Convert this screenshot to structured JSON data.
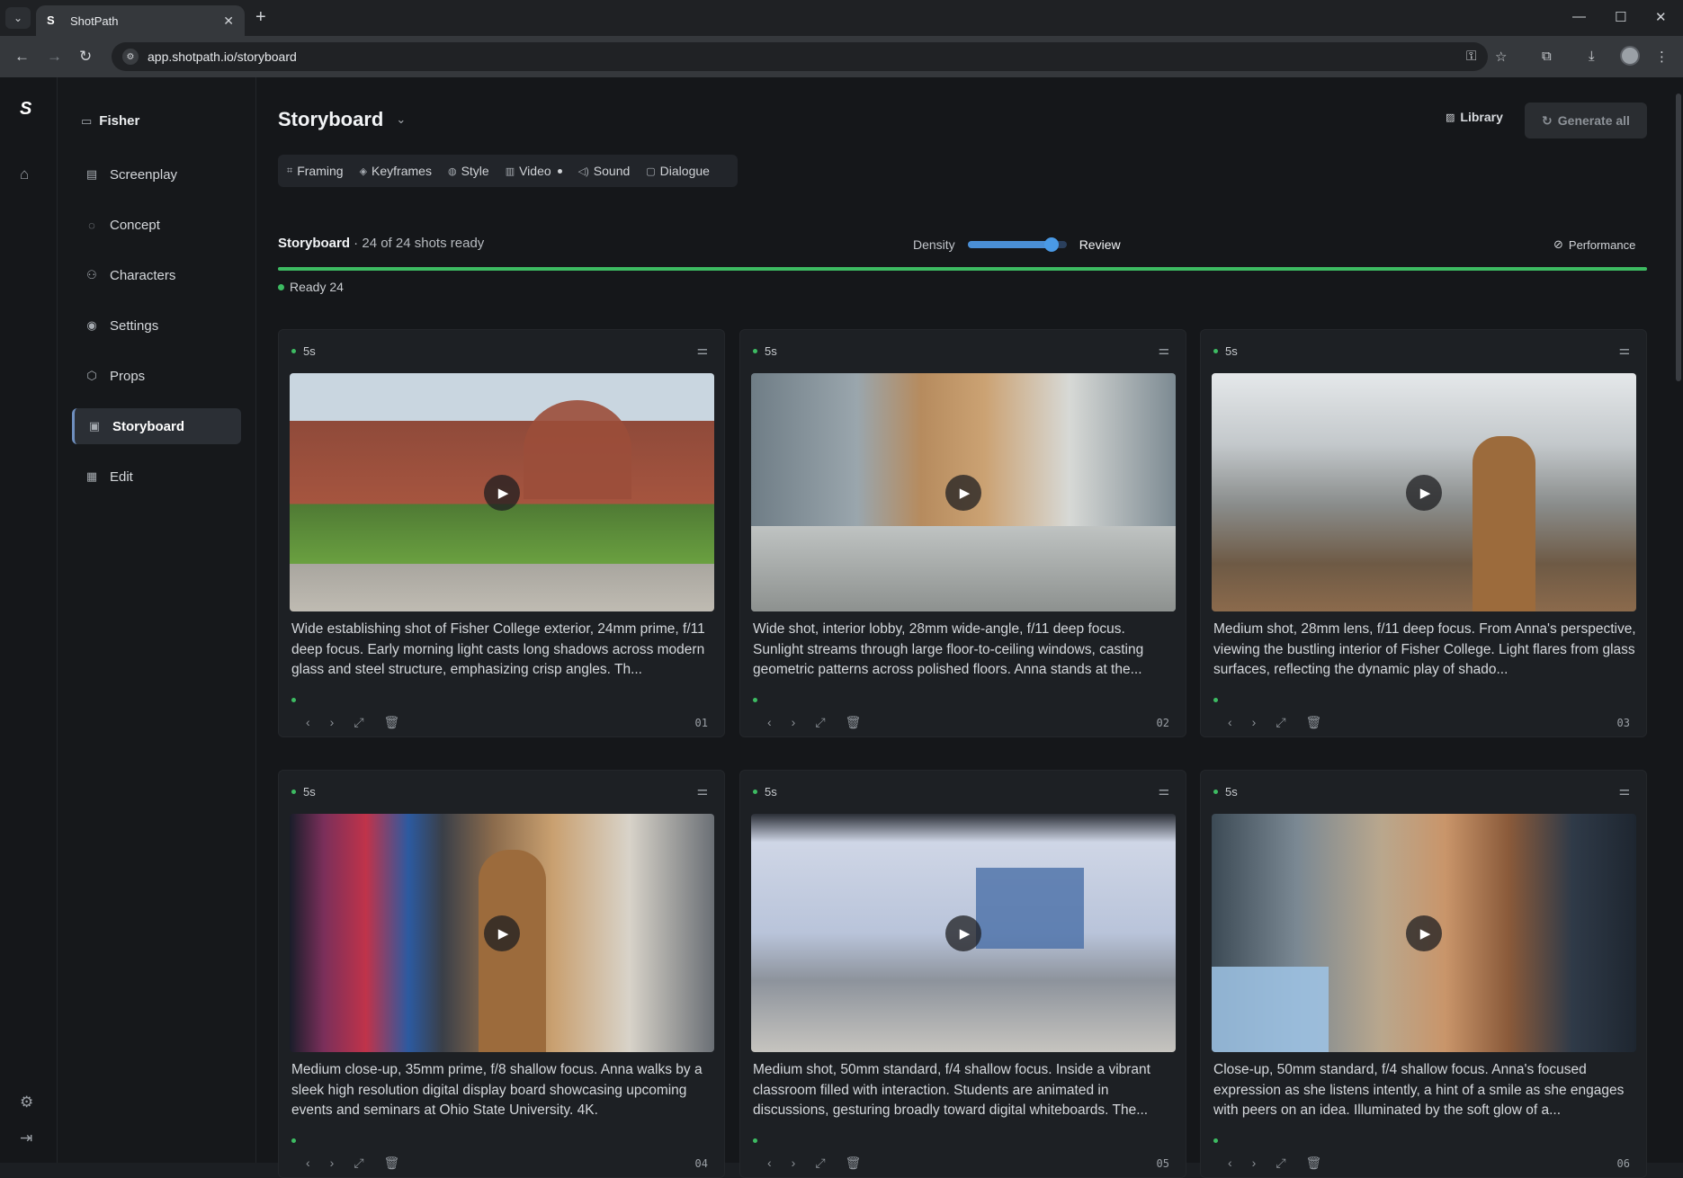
{
  "browser": {
    "tab_title": "ShotPath",
    "tab_favicon": "S",
    "url": "app.shotpath.io/storyboard"
  },
  "app": {
    "logo": "S",
    "project": "Fisher",
    "nav": [
      {
        "label": "Screenplay",
        "icon": "doc-icon"
      },
      {
        "label": "Concept",
        "icon": "lightbulb-icon"
      },
      {
        "label": "Characters",
        "icon": "users-icon"
      },
      {
        "label": "Settings",
        "icon": "pin-icon"
      },
      {
        "label": "Props",
        "icon": "box-icon"
      },
      {
        "label": "Storyboard",
        "icon": "storyboard-icon",
        "active": true
      },
      {
        "label": "Edit",
        "icon": "film-icon"
      }
    ]
  },
  "header": {
    "title": "Storyboard",
    "library_label": "Library",
    "generate_label": "Generate all"
  },
  "toolbar": {
    "framing": "Framing",
    "keyframes": "Keyframes",
    "style": "Style",
    "video": "Video",
    "sound": "Sound",
    "dialogue": "Dialogue"
  },
  "status": {
    "title": "Storyboard",
    "summary": "24 of 24 shots ready",
    "density_label": "Density",
    "density_mode": "Review",
    "density_value": 0.85,
    "performance_label": "Performance",
    "progress": 1.0,
    "ready_label": "Ready 24"
  },
  "shots": [
    {
      "duration": "5s",
      "number": "01",
      "desc": "Wide establishing shot of Fisher College exterior, 24mm prime, f/11 deep focus. Early morning light casts long shadows across modern glass and steel structure, emphasizing crisp angles. Th..."
    },
    {
      "duration": "5s",
      "number": "02",
      "desc": "Wide shot, interior lobby, 28mm wide-angle, f/11 deep focus. Sunlight streams through large floor-to-ceiling windows, casting geometric patterns across polished floors. Anna stands at the..."
    },
    {
      "duration": "5s",
      "number": "03",
      "desc": "Medium shot, 28mm lens, f/11 deep focus. From Anna's perspective, viewing the bustling interior of Fisher College. Light flares from glass surfaces, reflecting the dynamic play of shado..."
    },
    {
      "duration": "5s",
      "number": "04",
      "desc": "Medium close-up, 35mm prime, f/8 shallow focus. Anna walks by a sleek high resolution digital display board showcasing upcoming events and seminars at Ohio State University. 4K."
    },
    {
      "duration": "5s",
      "number": "05",
      "desc": "Medium shot, 50mm standard, f/4 shallow focus. Inside a vibrant classroom filled with interaction. Students are animated in discussions, gesturing broadly toward digital whiteboards. The..."
    },
    {
      "duration": "5s",
      "number": "06",
      "desc": "Close-up, 50mm standard, f/4 shallow focus. Anna's focused expression as she listens intently, a hint of a smile as she engages with peers on an idea. Illuminated by the soft glow of a..."
    }
  ]
}
